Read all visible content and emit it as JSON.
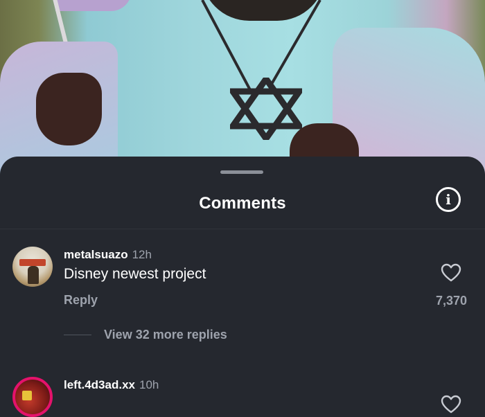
{
  "sheet": {
    "title": "Comments"
  },
  "comments": [
    {
      "username": "metalsuazo",
      "time": "12h",
      "text": "Disney newest project",
      "reply_label": "Reply",
      "likes": "7,370",
      "view_replies": "View 32 more replies"
    },
    {
      "username": "left.4d3ad.xx",
      "time": "10h"
    }
  ],
  "icons": {
    "info": "info-circle-icon",
    "like": "heart-outline-icon"
  },
  "colors": {
    "sheet_background": "#25282f",
    "secondary_text": "#9ea3ad",
    "story_ring": "#e4126b"
  }
}
